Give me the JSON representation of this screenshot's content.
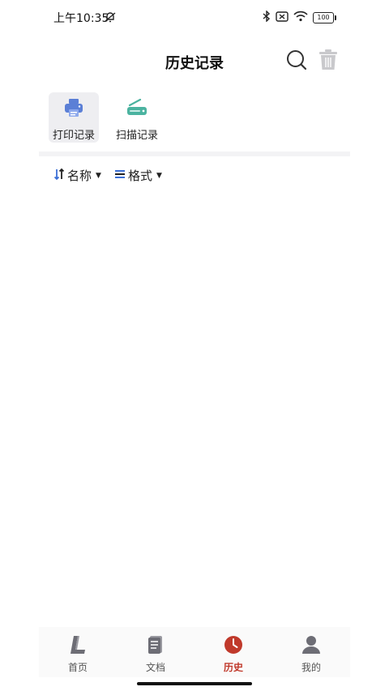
{
  "status_bar": {
    "time": "上午10:35",
    "battery": "100"
  },
  "header": {
    "title": "历史记录"
  },
  "record_tabs": [
    {
      "label": "打印记录",
      "icon": "printer-icon",
      "active": true
    },
    {
      "label": "扫描记录",
      "icon": "scanner-icon",
      "active": false
    }
  ],
  "filters": [
    {
      "label": "名称",
      "icon": "sort-icon"
    },
    {
      "label": "格式",
      "icon": "list-icon"
    }
  ],
  "bottom_nav": [
    {
      "label": "首页",
      "icon": "home-icon",
      "active": false
    },
    {
      "label": "文档",
      "icon": "document-icon",
      "active": false
    },
    {
      "label": "历史",
      "icon": "clock-icon",
      "active": true
    },
    {
      "label": "我的",
      "icon": "person-icon",
      "active": false
    }
  ],
  "colors": {
    "accent": "#c0392b",
    "printer": "#5b7fd6",
    "scanner": "#4bb3a0"
  }
}
